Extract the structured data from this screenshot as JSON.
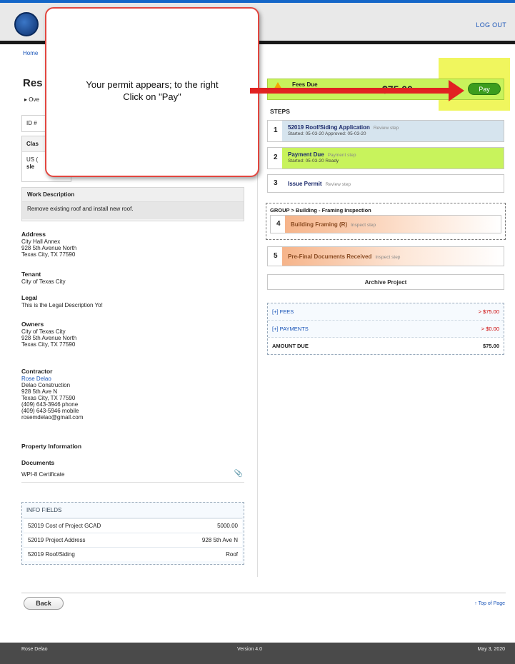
{
  "header": {
    "logout": "LOG OUT"
  },
  "breadcrumb": "Home",
  "page": {
    "title": "Res",
    "overview": "Ove"
  },
  "id_label": "ID #",
  "class_box": {
    "heading": "Clas",
    "line1": "US (",
    "line2": "sle"
  },
  "work_description": {
    "heading": "Work Description",
    "text": "Remove existing roof and install new roof."
  },
  "address": {
    "label": "Address",
    "lines": [
      "City Hall Annex",
      "928 5th Avenue North",
      "Texas City, TX 77590"
    ]
  },
  "tenant": {
    "label": "Tenant",
    "value": "City of Texas City"
  },
  "legal": {
    "label": "Legal",
    "value": "This is the Legal Description Yo!"
  },
  "owners": {
    "label": "Owners",
    "lines": [
      "City of Texas City",
      "928 5th Avenue North",
      "Texas City, TX 77590"
    ]
  },
  "contractor": {
    "label": "Contractor",
    "name": "Rose Delao",
    "lines": [
      "Delao Construction",
      "928 5th Ave N",
      "Texas City, TX 77590",
      "(409) 643-3946 phone",
      "(409) 643-5946 mobile",
      "rosemdelao@gmail.com"
    ]
  },
  "property_info": "Property Information",
  "documents": {
    "label": "Documents",
    "item": "WPI-8 Certificate"
  },
  "info_fields": {
    "heading": "INFO FIELDS",
    "rows": [
      {
        "name": "52019 Cost of Project GCAD",
        "value": "5000.00"
      },
      {
        "name": "52019 Project Address",
        "value": "928 5th Ave N"
      },
      {
        "name": "52019 Roof/Siding",
        "value": "Roof"
      }
    ]
  },
  "fees_due": {
    "label": "Fees Due",
    "amount": "$75.00",
    "pay": "Pay"
  },
  "steps": {
    "heading": "STEPS",
    "items": [
      {
        "num": "1",
        "title": "52019 Roof/Siding Application",
        "tag": "Review step",
        "sub": "Started: 05-03-20     Approved: 05-03-20"
      },
      {
        "num": "2",
        "title": "Payment Due",
        "tag": "Payment step",
        "sub": "Started: 05-03-20     Ready"
      },
      {
        "num": "3",
        "title": "Issue Permit",
        "tag": "Review step",
        "sub": ""
      },
      {
        "num": "4",
        "title": "Building Framing (R)",
        "tag": "Inspect step",
        "sub": ""
      },
      {
        "num": "5",
        "title": "Pre-Final Documents Received",
        "tag": "Inspect step",
        "sub": ""
      }
    ],
    "group": "GROUP > Building - Framing Inspection"
  },
  "archive": "Archive Project",
  "totals": {
    "fees_label": "[+] FEES",
    "fees_value": "> $75.00",
    "payments_label": "[+] PAYMENTS",
    "payments_value": "> $0.00",
    "due_label": "AMOUNT DUE",
    "due_value": "$75.00"
  },
  "callout": {
    "line1": "Your permit appears; to the right",
    "line2": "Click on \"Pay\""
  },
  "nav": {
    "back": "Back",
    "top": "Top of Page"
  },
  "footer": {
    "user": "Rose Delao",
    "version": "Version 4.0",
    "date": "May 3, 2020"
  },
  "colors": {
    "accent": "#1466c8",
    "pay_green": "#3c9d1e",
    "fees_bar": "#c8f35c",
    "callout_red": "#e2463f"
  }
}
